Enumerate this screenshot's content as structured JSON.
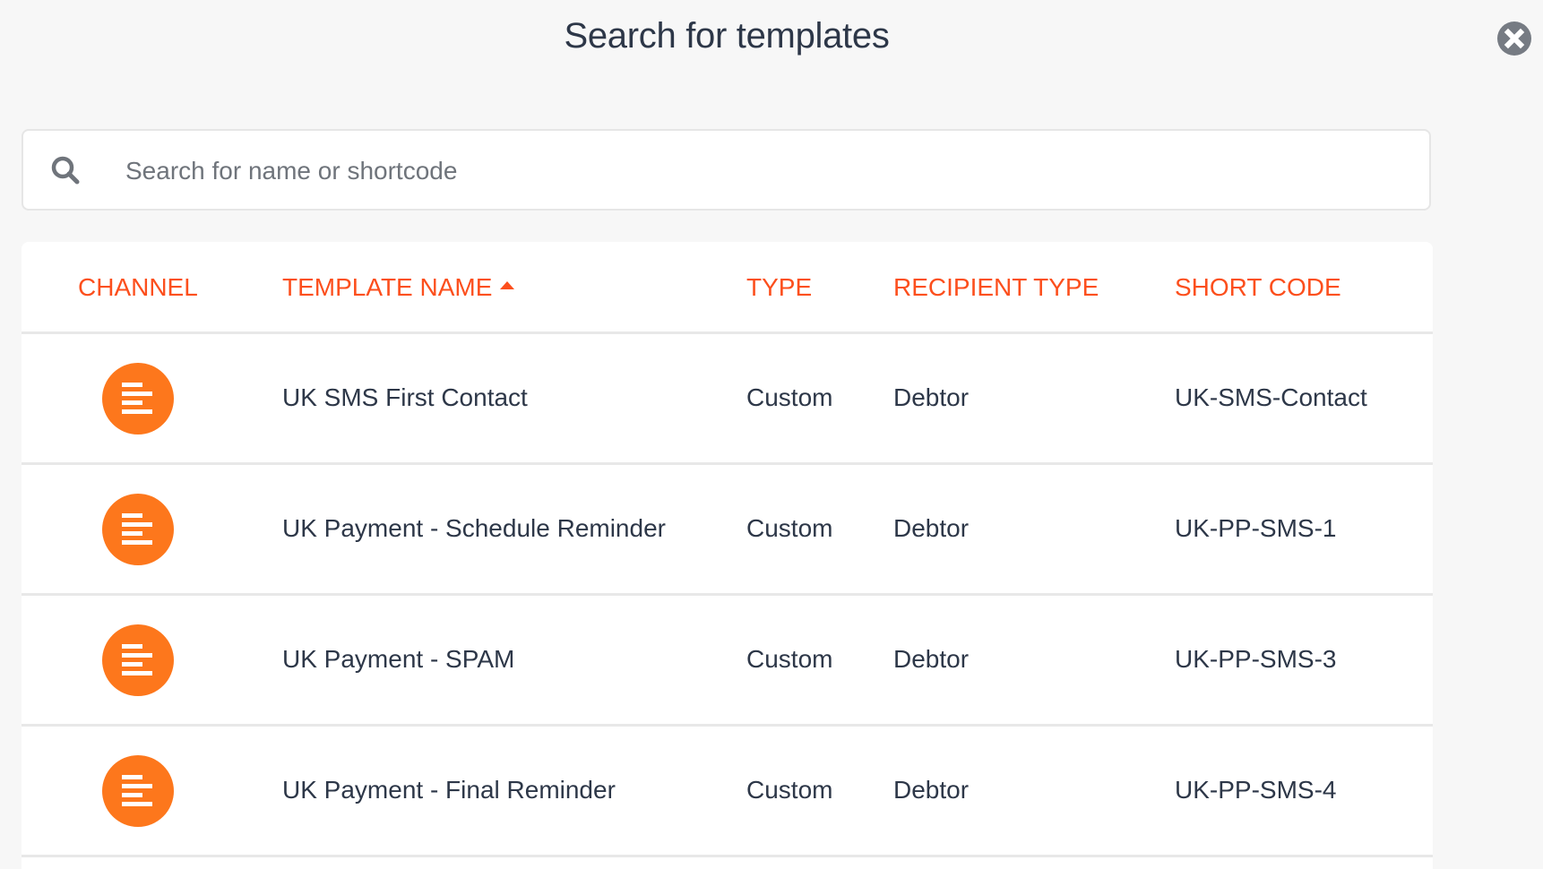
{
  "dialog": {
    "title": "Search for templates",
    "close_icon": "close-circle-icon"
  },
  "search": {
    "placeholder": "Search for name or shortcode",
    "value": "",
    "icon": "search-icon"
  },
  "table": {
    "columns": [
      {
        "key": "channel",
        "label": "CHANNEL"
      },
      {
        "key": "template_name",
        "label": "TEMPLATE NAME",
        "sorted": "ascending"
      },
      {
        "key": "type",
        "label": "TYPE"
      },
      {
        "key": "recipient_type",
        "label": "RECIPIENT TYPE"
      },
      {
        "key": "short_code",
        "label": "SHORT CODE"
      }
    ],
    "rows": [
      {
        "channel": "sms",
        "channel_icon": "message-lines-icon",
        "template_name": "UK SMS First Contact",
        "type": "Custom",
        "recipient_type": "Debtor",
        "short_code": "UK-SMS-Contact"
      },
      {
        "channel": "sms",
        "channel_icon": "message-lines-icon",
        "template_name": "UK Payment - Schedule Reminder",
        "type": "Custom",
        "recipient_type": "Debtor",
        "short_code": "UK-PP-SMS-1"
      },
      {
        "channel": "sms",
        "channel_icon": "message-lines-icon",
        "template_name": "UK Payment - SPAM",
        "type": "Custom",
        "recipient_type": "Debtor",
        "short_code": "UK-PP-SMS-3"
      },
      {
        "channel": "sms",
        "channel_icon": "message-lines-icon",
        "template_name": "UK Payment - Final Reminder",
        "type": "Custom",
        "recipient_type": "Debtor",
        "short_code": "UK-PP-SMS-4"
      }
    ]
  },
  "colors": {
    "accent": "#fc4f1d",
    "channel_icon_bg": "#fd771c",
    "text": "#2d3748",
    "muted": "#6f747b",
    "background": "#f7f7f7"
  }
}
